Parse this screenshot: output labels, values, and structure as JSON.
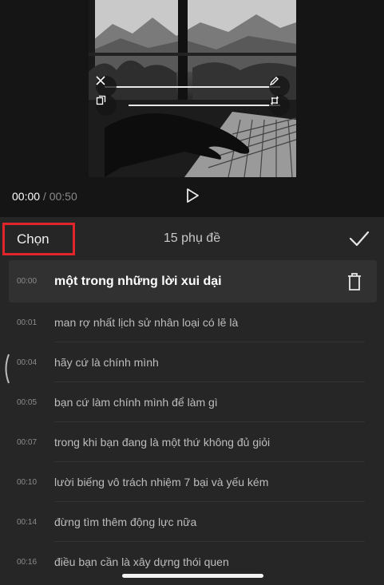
{
  "player": {
    "current_time": "00:00",
    "separator": " / ",
    "total_time": "00:50",
    "play_icon": "play-icon"
  },
  "overlay": {
    "close_icon": "close-icon",
    "edit_icon": "pencil-icon",
    "copy_icon": "copy-icon",
    "scale_icon": "rotate-scale-icon"
  },
  "header": {
    "select_label": "Chọn",
    "count_label": "15 phụ đề",
    "confirm_icon": "checkmark-icon"
  },
  "subtitles": [
    {
      "time": "00:00",
      "text": "một trong những lời xui dại",
      "selected": true
    },
    {
      "time": "00:01",
      "text": "man rợ nhất lịch sử nhân loại có lẽ là",
      "selected": false
    },
    {
      "time": "00:04",
      "text": "hãy cứ là chính mình",
      "selected": false
    },
    {
      "time": "00:05",
      "text": "bạn cứ làm chính mình để làm gì",
      "selected": false
    },
    {
      "time": "00:07",
      "text": "trong khi bạn đang là một thứ không đủ giỏi",
      "selected": false
    },
    {
      "time": "00:10",
      "text": "lười biếng vô trách nhiệm 7 bại và yếu kém",
      "selected": false
    },
    {
      "time": "00:14",
      "text": "đừng tìm thêm động lực nữa",
      "selected": false
    },
    {
      "time": "00:16",
      "text": "điều bạn cần là xây dựng thói quen",
      "selected": false
    }
  ],
  "colors": {
    "highlight_border": "#e0252b",
    "background": "#262626",
    "selected_row": "#313131"
  }
}
